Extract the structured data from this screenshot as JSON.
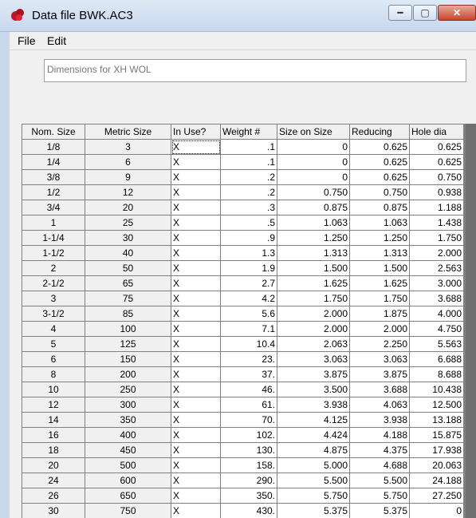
{
  "window": {
    "title": "Data file BWK.AC3"
  },
  "menu": {
    "items": [
      "File",
      "Edit"
    ]
  },
  "description": {
    "value": "Dimensions for XH WOL"
  },
  "table": {
    "headers": [
      "Nom. Size",
      "Metric Size",
      "In Use?",
      "Weight #",
      "Size on Size",
      "Reducing",
      "Hole dia"
    ],
    "rows": [
      [
        "1/8",
        "3",
        "X",
        ".1",
        "0",
        "0.625",
        "0.625"
      ],
      [
        "1/4",
        "6",
        "X",
        ".1",
        "0",
        "0.625",
        "0.625"
      ],
      [
        "3/8",
        "9",
        "X",
        ".2",
        "0",
        "0.625",
        "0.750"
      ],
      [
        "1/2",
        "12",
        "X",
        ".2",
        "0.750",
        "0.750",
        "0.938"
      ],
      [
        "3/4",
        "20",
        "X",
        ".3",
        "0.875",
        "0.875",
        "1.188"
      ],
      [
        "1",
        "25",
        "X",
        ".5",
        "1.063",
        "1.063",
        "1.438"
      ],
      [
        "1-1/4",
        "30",
        "X",
        ".9",
        "1.250",
        "1.250",
        "1.750"
      ],
      [
        "1-1/2",
        "40",
        "X",
        "1.3",
        "1.313",
        "1.313",
        "2.000"
      ],
      [
        "2",
        "50",
        "X",
        "1.9",
        "1.500",
        "1.500",
        "2.563"
      ],
      [
        "2-1/2",
        "65",
        "X",
        "2.7",
        "1.625",
        "1.625",
        "3.000"
      ],
      [
        "3",
        "75",
        "X",
        "4.2",
        "1.750",
        "1.750",
        "3.688"
      ],
      [
        "3-1/2",
        "85",
        "X",
        "5.6",
        "2.000",
        "1.875",
        "4.000"
      ],
      [
        "4",
        "100",
        "X",
        "7.1",
        "2.000",
        "2.000",
        "4.750"
      ],
      [
        "5",
        "125",
        "X",
        "10.4",
        "2.063",
        "2.250",
        "5.563"
      ],
      [
        "6",
        "150",
        "X",
        "23.",
        "3.063",
        "3.063",
        "6.688"
      ],
      [
        "8",
        "200",
        "X",
        "37.",
        "3.875",
        "3.875",
        "8.688"
      ],
      [
        "10",
        "250",
        "X",
        "46.",
        "3.500",
        "3.688",
        "10.438"
      ],
      [
        "12",
        "300",
        "X",
        "61.",
        "3.938",
        "4.063",
        "12.500"
      ],
      [
        "14",
        "350",
        "X",
        "70.",
        "4.125",
        "3.938",
        "13.188"
      ],
      [
        "16",
        "400",
        "X",
        "102.",
        "4.424",
        "4.188",
        "15.875"
      ],
      [
        "18",
        "450",
        "X",
        "130.",
        "4.875",
        "4.375",
        "17.938"
      ],
      [
        "20",
        "500",
        "X",
        "158.",
        "5.000",
        "4.688",
        "20.063"
      ],
      [
        "24",
        "600",
        "X",
        "290.",
        "5.500",
        "5.500",
        "24.188"
      ],
      [
        "26",
        "650",
        "X",
        "350.",
        "5.750",
        "5.750",
        "27.250"
      ],
      [
        "30",
        "750",
        "X",
        "430.",
        "5.375",
        "5.375",
        "0"
      ]
    ]
  },
  "icons": {
    "app": "app-red-icon",
    "minimize": "minimize-icon",
    "maximize": "maximize-icon",
    "close": "close-icon"
  },
  "colors": {
    "accent_close": "#c7462f",
    "header_bg": "#f0f0f0"
  }
}
